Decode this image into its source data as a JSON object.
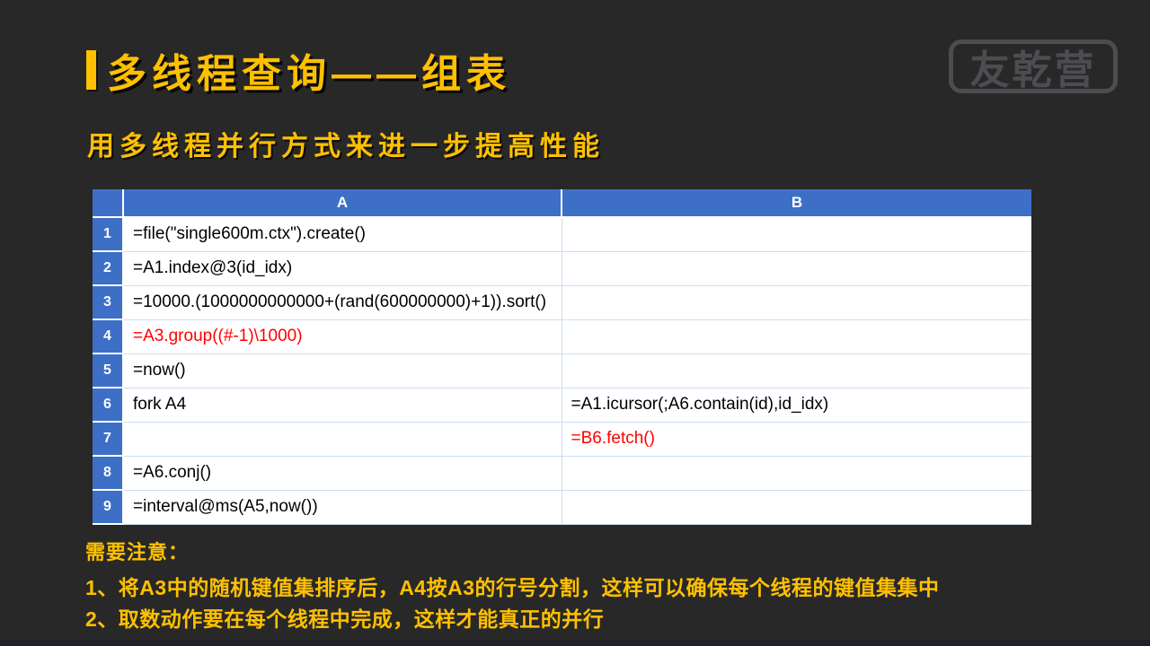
{
  "slide": {
    "title": "多线程查询——组表",
    "subtitle": "用多线程并行方式来进一步提高性能",
    "logo_text": "友乾营",
    "notes_heading": "需要注意：",
    "note1": "1、将A3中的随机键值集排序后，A4按A3的行号分割，这样可以确保每个线程的键值集集中",
    "note2": "2、取数动作要在每个线程中完成，这样才能真正的并行"
  },
  "colors": {
    "slide_background": "#282828",
    "accent_yellow": "#FFC000",
    "header_blue": "#3D6FC7",
    "highlight_red": "#FF0000"
  },
  "table": {
    "columns": [
      "A",
      "B"
    ],
    "rows": [
      {
        "num": "1",
        "a": {
          "text": "=file(\"single600m.ctx\").create()",
          "color": "black"
        },
        "b": {
          "text": "",
          "color": "black"
        }
      },
      {
        "num": "2",
        "a": {
          "text": "=A1.index@3(id_idx)",
          "color": "black"
        },
        "b": {
          "text": "",
          "color": "black"
        }
      },
      {
        "num": "3",
        "a": {
          "text": "=10000.(1000000000000+(rand(600000000)+1)).sort()",
          "color": "black"
        },
        "b": {
          "text": "",
          "color": "black"
        }
      },
      {
        "num": "4",
        "a": {
          "text": "=A3.group((#-1)\\1000)",
          "color": "red"
        },
        "b": {
          "text": "",
          "color": "black"
        }
      },
      {
        "num": "5",
        "a": {
          "text": "=now()",
          "color": "black"
        },
        "b": {
          "text": "",
          "color": "black"
        }
      },
      {
        "num": "6",
        "a": {
          "text": "fork A4",
          "color": "black"
        },
        "b": {
          "text": "=A1.icursor(;A6.contain(id),id_idx)",
          "color": "black"
        }
      },
      {
        "num": "7",
        "a": {
          "text": "",
          "color": "black"
        },
        "b": {
          "text": "=B6.fetch()",
          "color": "red"
        }
      },
      {
        "num": "8",
        "a": {
          "text": "=A6.conj()",
          "color": "black"
        },
        "b": {
          "text": "",
          "color": "black"
        }
      },
      {
        "num": "9",
        "a": {
          "text": "=interval@ms(A5,now())",
          "color": "black"
        },
        "b": {
          "text": "",
          "color": "black"
        }
      }
    ]
  }
}
